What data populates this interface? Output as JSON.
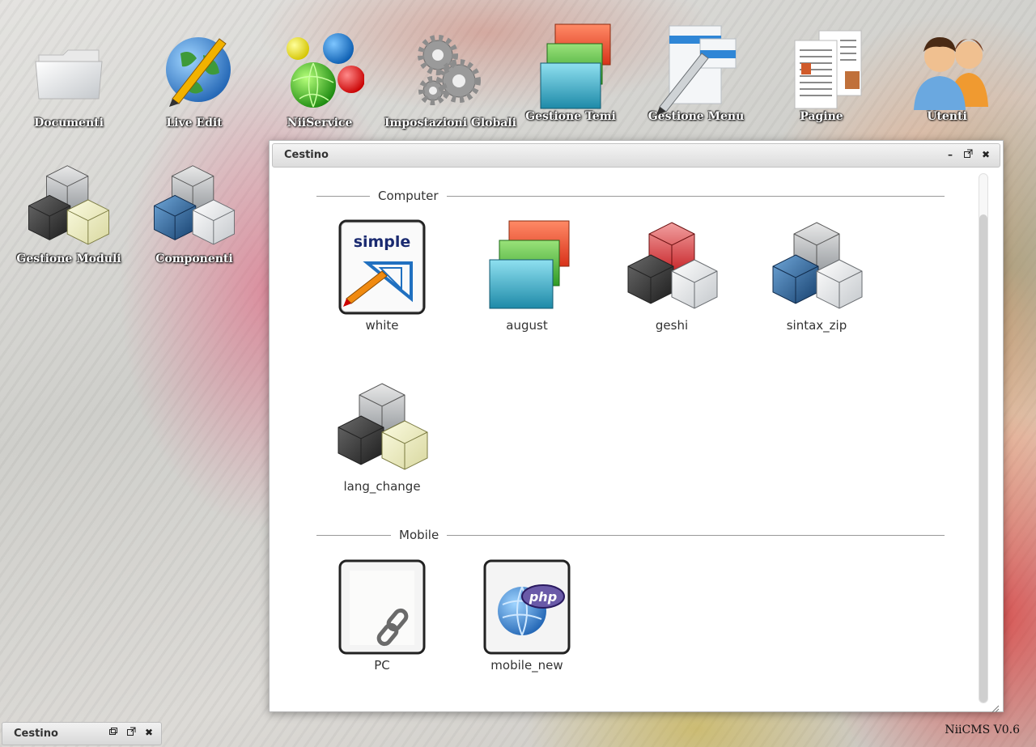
{
  "desktop": {
    "icons": [
      {
        "label": "Documenti",
        "icon": "folder-icon"
      },
      {
        "label": "Live Edit",
        "icon": "globe-pencil-icon"
      },
      {
        "label": "NiiService",
        "icon": "colored-balls-icon"
      },
      {
        "label": "Impostazioni Globali",
        "icon": "gears-icon"
      },
      {
        "label": "Gestione Temi",
        "icon": "stacked-windows-icon"
      },
      {
        "label": "Gestione Menu",
        "icon": "menu-pen-icon"
      },
      {
        "label": "Pagine",
        "icon": "pages-icon"
      },
      {
        "label": "Utenti",
        "icon": "users-icon"
      },
      {
        "label": "Gestione Moduli",
        "icon": "cubes-icon"
      },
      {
        "label": "Componenti",
        "icon": "cubes-blue-icon"
      }
    ]
  },
  "window": {
    "title": "Cestino",
    "sections": [
      {
        "caption": "Computer",
        "items": [
          {
            "label": "white",
            "icon": "simple-theme-icon"
          },
          {
            "label": "august",
            "icon": "stacked-windows-icon"
          },
          {
            "label": "geshi",
            "icon": "cubes-red-icon"
          },
          {
            "label": "sintax_zip",
            "icon": "cubes-blue-icon"
          },
          {
            "label": "lang_change",
            "icon": "cubes-yellow-icon"
          }
        ]
      },
      {
        "caption": "Mobile",
        "items": [
          {
            "label": "PC",
            "icon": "link-page-icon"
          },
          {
            "label": "mobile_new",
            "icon": "php-globe-icon"
          }
        ]
      }
    ],
    "simple_badge": "simple",
    "php_badge": "php"
  },
  "taskbar": {
    "title": "Cestino"
  },
  "footer": {
    "version": "NiiCMS V0.6"
  },
  "colors": {
    "red": "#e8452a",
    "green": "#4cb83a",
    "teal": "#3aa7c7",
    "blue": "#2d6ea8"
  }
}
